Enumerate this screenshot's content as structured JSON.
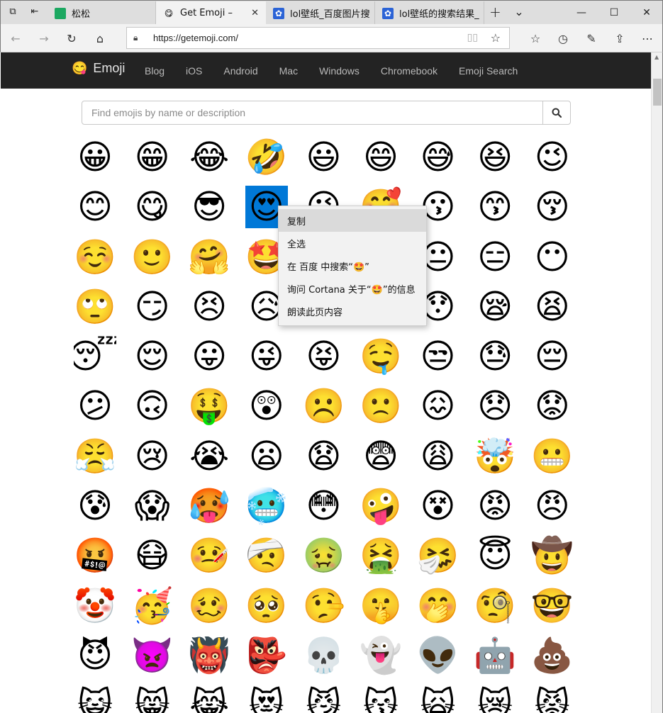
{
  "titlebar": {
    "tabs": [
      {
        "title": "松松",
        "favicon": "green-sheet-icon",
        "active": false
      },
      {
        "title": "Get Emoji –",
        "favicon": "😋",
        "active": true
      },
      {
        "title": "lol壁纸_百度图片搜",
        "favicon": "baidu-paw-icon",
        "active": false
      },
      {
        "title": "lol壁纸的搜索结果_",
        "favicon": "baidu-paw-icon",
        "active": false
      }
    ],
    "new_tab": "+",
    "tab_list": "⌄",
    "minimize": "—",
    "maximize": "☐",
    "close": "✕"
  },
  "navbar": {
    "url": "https://getemoji.com/"
  },
  "site": {
    "brand_logo": "😋",
    "brand": "Emoji",
    "nav": [
      "Blog",
      "iOS",
      "Android",
      "Mac",
      "Windows",
      "Chromebook",
      "Emoji Search"
    ],
    "search_placeholder": "Find emojis by name or description"
  },
  "emojis": [
    "😀",
    "😁",
    "😂",
    "🤣",
    "😃",
    "😄",
    "😅",
    "😆",
    "😉",
    "😊",
    "😋",
    "😎",
    "😍",
    "😘",
    "🥰",
    "😗",
    "😙",
    "😚",
    "☺️",
    "🙂",
    "🤗",
    "🤩",
    "🤔",
    "🤨",
    "😐",
    "😑",
    "😶",
    "🙄",
    "😏",
    "😣",
    "😥",
    "😮",
    "🤐",
    "😯",
    "😪",
    "😫",
    "😴",
    "😌",
    "😛",
    "😜",
    "😝",
    "🤤",
    "😒",
    "😓",
    "😔",
    "😕",
    "🙃",
    "🤑",
    "😲",
    "☹️",
    "🙁",
    "😖",
    "😞",
    "😟",
    "😤",
    "😢",
    "😭",
    "😦",
    "😧",
    "😨",
    "😩",
    "🤯",
    "😬",
    "😰",
    "😱",
    "🥵",
    "🥶",
    "😳",
    "🤪",
    "😵",
    "😡",
    "😠",
    "🤬",
    "😷",
    "🤒",
    "🤕",
    "🤢",
    "🤮",
    "🤧",
    "😇",
    "🤠",
    "🤡",
    "🥳",
    "🥴",
    "🥺",
    "🤥",
    "🤫",
    "🤭",
    "🧐",
    "🤓",
    "😈",
    "👿",
    "👹",
    "👺",
    "💀",
    "👻",
    "👽",
    "🤖",
    "💩",
    "😺",
    "😸",
    "😹",
    "😻",
    "😼",
    "😽",
    "🙀",
    "😿",
    "😾"
  ],
  "selected_index": 12,
  "context_menu": {
    "items": [
      "复制",
      "全选",
      "在 百度 中搜索“🤩”",
      "询问 Cortana 关于“🤩”的信息",
      "朗读此页内容"
    ],
    "highlighted_index": 0
  }
}
